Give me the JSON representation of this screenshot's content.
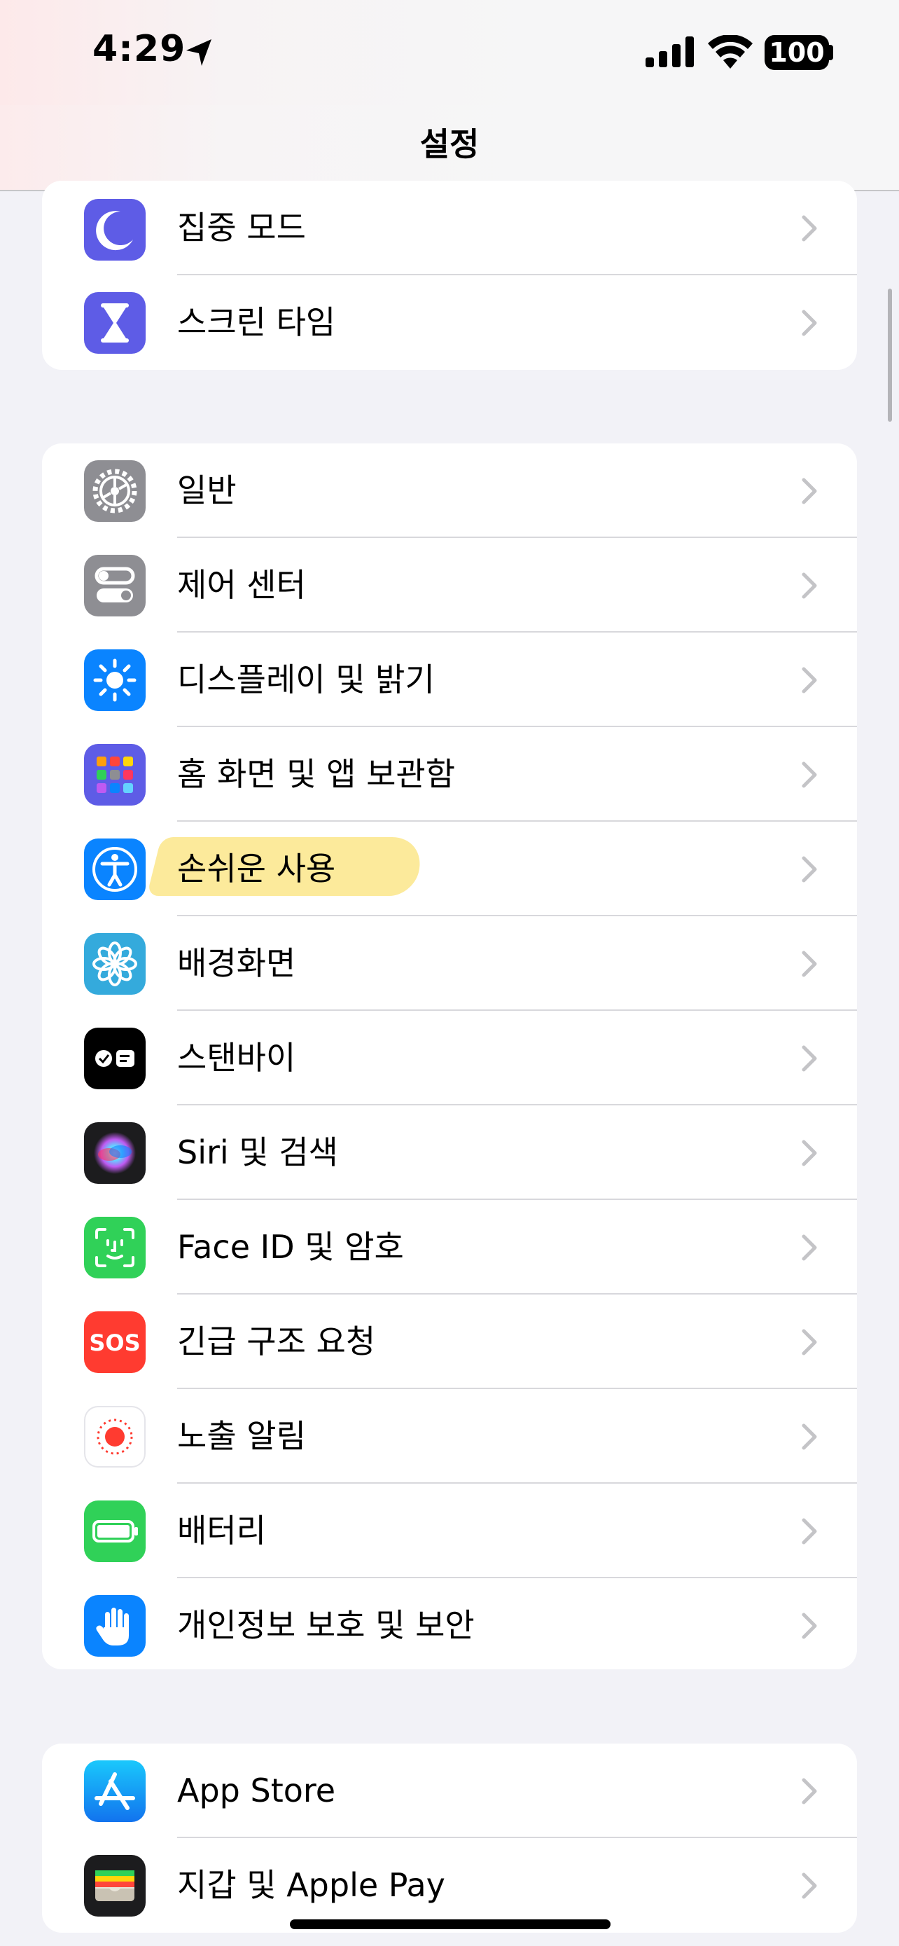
{
  "status_bar": {
    "time": "4:29",
    "battery": "100",
    "icons": [
      "location-arrow-icon",
      "cellular-signal-icon",
      "wifi-icon",
      "battery-icon"
    ]
  },
  "nav": {
    "title": "설정"
  },
  "groups": [
    {
      "items": [
        {
          "label": "집중 모드",
          "icon": "moon-icon",
          "icon_color": "#5e5ce6"
        },
        {
          "label": "스크린 타임",
          "icon": "hourglass-icon",
          "icon_color": "#5e5ce6"
        }
      ]
    },
    {
      "items": [
        {
          "label": "일반",
          "icon": "gear-icon",
          "icon_color": "#8e8e93"
        },
        {
          "label": "제어 센터",
          "icon": "toggles-icon",
          "icon_color": "#8e8e93"
        },
        {
          "label": "디스플레이 및 밝기",
          "icon": "sun-icon",
          "icon_color": "#0a84ff"
        },
        {
          "label": "홈 화면 및 앱 보관함",
          "icon": "app-grid-icon",
          "icon_color": "#5e5ce6"
        },
        {
          "label": "손쉬운 사용",
          "icon": "accessibility-icon",
          "icon_color": "#0a84ff",
          "highlighted": true
        },
        {
          "label": "배경화면",
          "icon": "flower-icon",
          "icon_color": "#34aadc"
        },
        {
          "label": "스탠바이",
          "icon": "standby-icon",
          "icon_color": "#000000"
        },
        {
          "label": "Siri 및 검색",
          "icon": "siri-icon",
          "icon_color": "#1c1c1e"
        },
        {
          "label": "Face ID 및 암호",
          "icon": "face-id-icon",
          "icon_color": "#30d158"
        },
        {
          "label": "긴급 구조 요청",
          "icon": "sos-icon",
          "icon_color": "#ff3b30",
          "icon_text": "SOS"
        },
        {
          "label": "노출 알림",
          "icon": "exposure-notification-icon",
          "icon_color": "#ffffff"
        },
        {
          "label": "배터리",
          "icon": "battery-setting-icon",
          "icon_color": "#30d158"
        },
        {
          "label": "개인정보 보호 및 보안",
          "icon": "hand-icon",
          "icon_color": "#0a84ff"
        }
      ]
    },
    {
      "items": [
        {
          "label": "App Store",
          "icon": "app-store-icon",
          "icon_color": "#0a84ff"
        },
        {
          "label": "지갑 및 Apple Pay",
          "icon": "wallet-icon",
          "icon_color": "#1c1c1e"
        }
      ]
    }
  ],
  "colors": {
    "background": "#f2f2f7",
    "highlight": "#fbe68a",
    "chevron": "#c4c4c7"
  }
}
